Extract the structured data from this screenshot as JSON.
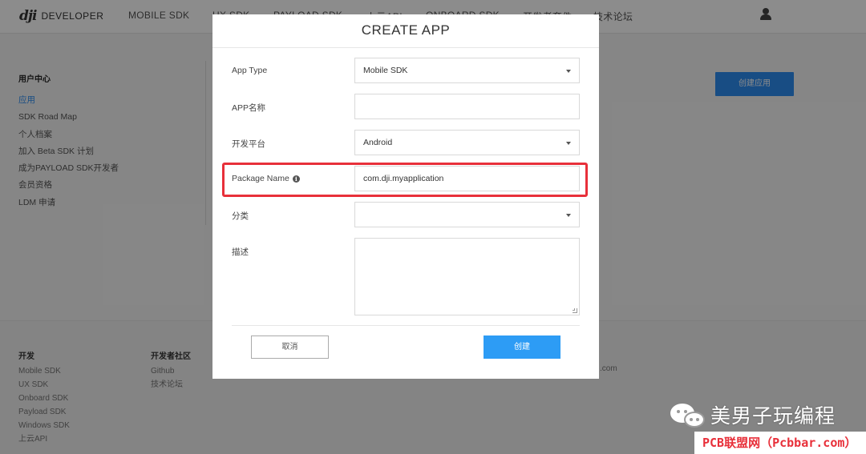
{
  "topnav": {
    "logo_text": "DEVELOPER",
    "items": [
      "MOBILE SDK",
      "UX SDK",
      "PAYLOAD SDK",
      "上云API",
      "ONBOARD SDK",
      "开发者套件",
      "技术论坛"
    ]
  },
  "sidebar": {
    "heading": "用户中心",
    "items": [
      "应用",
      "SDK Road Map",
      "个人档案",
      "加入 Beta SDK 计划",
      "成为PAYLOAD SDK开发者",
      "会员资格",
      "LDM 申请"
    ],
    "active_index": 0
  },
  "page": {
    "create_app_button": "创建应用"
  },
  "footer": {
    "col1": {
      "heading": "开发",
      "items": [
        "Mobile SDK",
        "UX SDK",
        "Onboard SDK",
        "Payload SDK",
        "Windows SDK",
        "上云API"
      ]
    },
    "col2": {
      "heading": "开发者社区",
      "items": [
        "Github",
        "技术论坛"
      ]
    },
    "extra_text": ".com"
  },
  "modal": {
    "title": "CREATE APP",
    "fields": {
      "app_type": {
        "label": "App Type",
        "value": "Mobile SDK"
      },
      "app_name": {
        "label": "APP名称",
        "value": ""
      },
      "platform": {
        "label": "开发平台",
        "value": "Android"
      },
      "package_name": {
        "label": "Package Name",
        "value": "com.dji.myapplication"
      },
      "category": {
        "label": "分类",
        "value": ""
      },
      "description": {
        "label": "描述",
        "value": ""
      }
    },
    "cancel_button": "取消",
    "create_button": "创建"
  },
  "watermark": {
    "account": "美男子玩编程",
    "site": "PCB联盟网（Pcbbar.com）"
  },
  "colors": {
    "accent": "#2d8cf0",
    "highlight": "#e8303a",
    "overlay": "rgba(0,0,0,0.45)"
  }
}
